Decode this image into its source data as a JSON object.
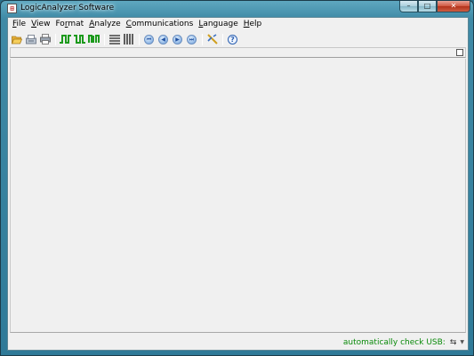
{
  "window": {
    "title": "LogicAnalyzer Software",
    "caption": {
      "minimize": "–",
      "maximize": "□",
      "close": "✕"
    }
  },
  "menu": [
    {
      "key": "F",
      "rest": "ile"
    },
    {
      "key": "V",
      "rest": "iew"
    },
    {
      "pre": "Fo",
      "key": "r",
      "rest": "mat"
    },
    {
      "key": "A",
      "rest": "nalyze"
    },
    {
      "key": "C",
      "rest": "ommunications"
    },
    {
      "key": "L",
      "rest": "anguage"
    },
    {
      "key": "H",
      "rest": "elp"
    }
  ],
  "toolbar": {
    "nav": {
      "first": "⏮",
      "prev": "◀",
      "next": "▶",
      "last": "⏭"
    },
    "help": "?"
  },
  "status": {
    "text": "automatically check USB:",
    "usb_icon": "⇆",
    "dropdown": "▼"
  },
  "colors": {
    "status_text": "#0a8a0a",
    "signal_green": "#1c9a1c",
    "help_blue": "#2a5fb0"
  }
}
